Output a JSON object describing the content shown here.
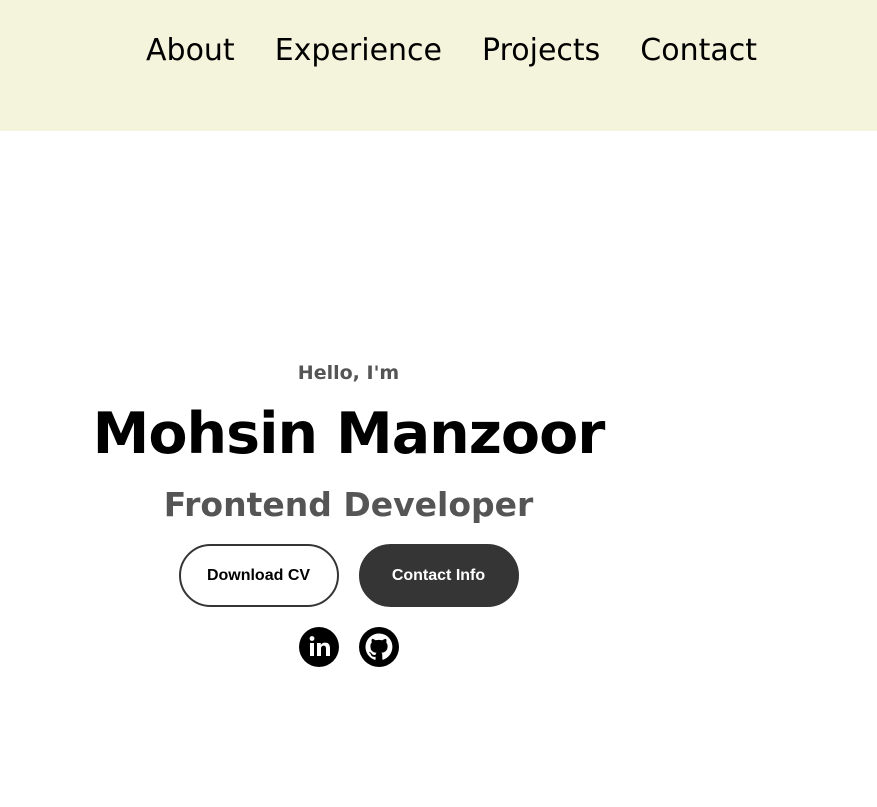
{
  "nav": {
    "items": [
      {
        "label": "About"
      },
      {
        "label": "Experience"
      },
      {
        "label": "Projects"
      },
      {
        "label": "Contact"
      }
    ]
  },
  "hero": {
    "greeting": "Hello, I'm",
    "name": "Mohsin Manzoor",
    "role": "Frontend Developer",
    "buttons": {
      "download": "Download CV",
      "contact": "Contact Info"
    },
    "socials": [
      {
        "icon": "linkedin-icon"
      },
      {
        "icon": "github-icon"
      }
    ]
  },
  "colors": {
    "nav_background": "#f4f4dc",
    "button_dark": "#353535",
    "muted_text": "#555555"
  }
}
